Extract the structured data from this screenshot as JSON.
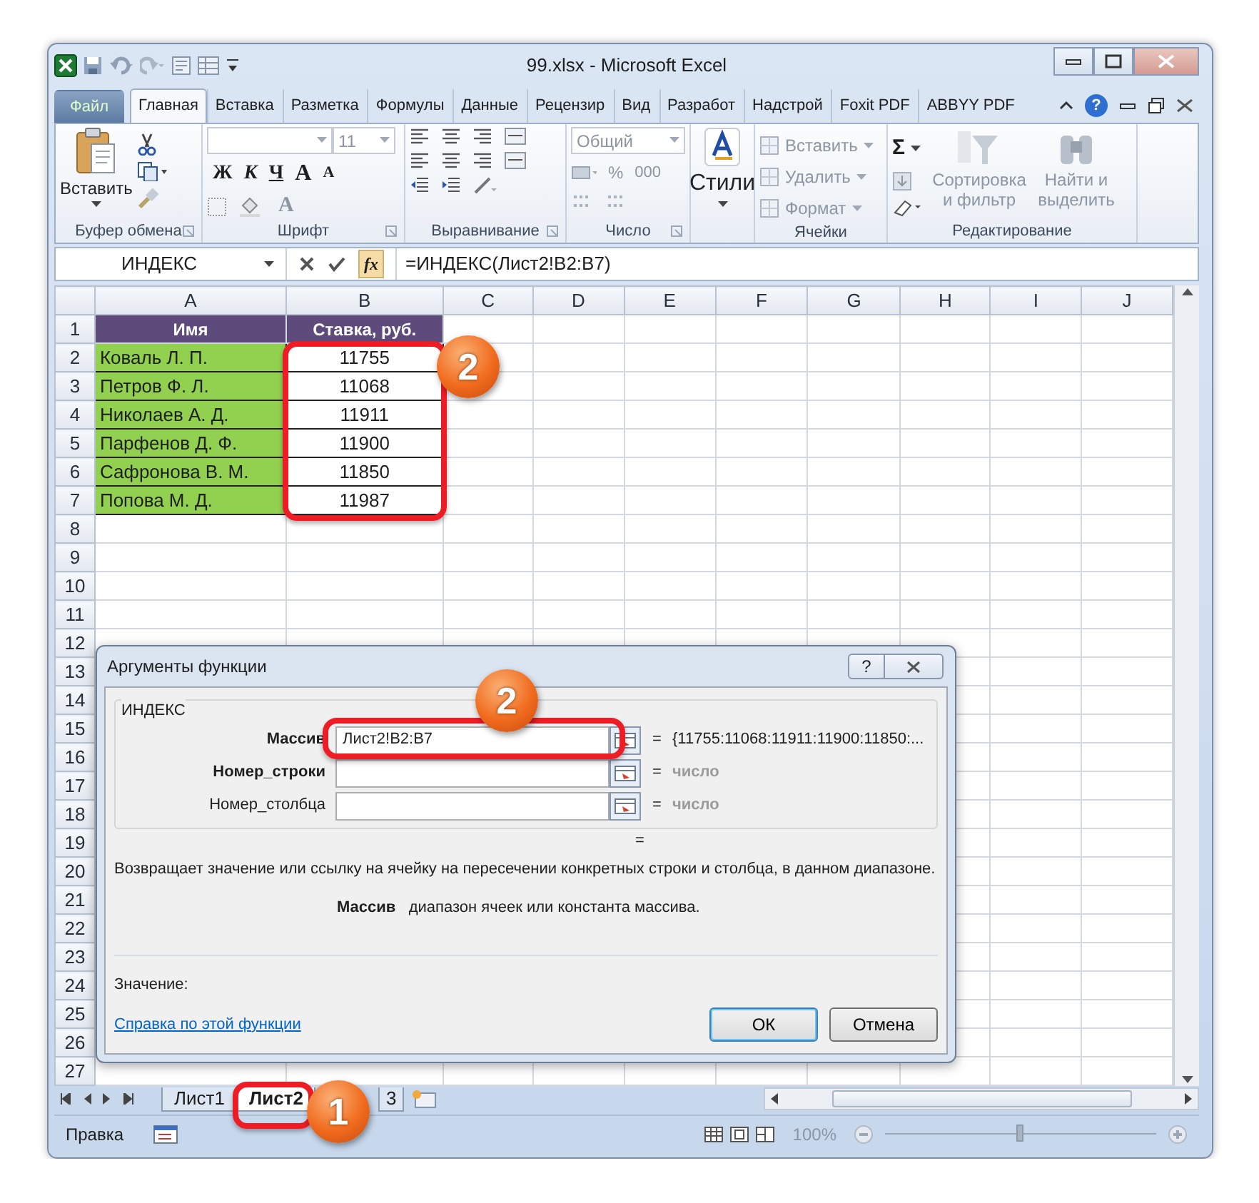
{
  "window": {
    "title": "99.xlsx - Microsoft Excel"
  },
  "ribbon_tabs": [
    {
      "label": "Файл",
      "kind": "file",
      "selected": false
    },
    {
      "label": "Главная",
      "kind": "tab",
      "selected": true
    },
    {
      "label": "Вставка",
      "kind": "tab",
      "selected": false
    },
    {
      "label": "Разметка",
      "kind": "tab",
      "selected": false
    },
    {
      "label": "Формулы",
      "kind": "tab",
      "selected": false
    },
    {
      "label": "Данные",
      "kind": "tab",
      "selected": false
    },
    {
      "label": "Рецензир",
      "kind": "tab",
      "selected": false
    },
    {
      "label": "Вид",
      "kind": "tab",
      "selected": false
    },
    {
      "label": "Разработ",
      "kind": "tab",
      "selected": false
    },
    {
      "label": "Надстрой",
      "kind": "tab",
      "selected": false
    },
    {
      "label": "Foxit PDF",
      "kind": "tab",
      "selected": false
    },
    {
      "label": "ABBYY PDF",
      "kind": "tab",
      "selected": false
    }
  ],
  "ribbon_help": "?",
  "ribbon_groups": [
    {
      "kind": "clipboard",
      "label": "Буфер обмена",
      "paste": "Вставить"
    },
    {
      "kind": "font",
      "label": "Шрифт",
      "font_size": "11",
      "styles": [
        "Ж",
        "К",
        "Ч"
      ],
      "grow": "A",
      "shrink": "A",
      "font_color": "A"
    },
    {
      "kind": "alignment",
      "label": "Выравнивание"
    },
    {
      "kind": "number",
      "label": "Число",
      "format": "Общий",
      "percent": "%",
      "thousands": "000",
      "disabled": true
    },
    {
      "kind": "styles",
      "label": "Стили"
    },
    {
      "kind": "cells",
      "label": "Ячейки",
      "commands": [
        "Вставить",
        "Удалить",
        "Формат"
      ],
      "disabled": true
    },
    {
      "kind": "editing",
      "label": "Редактирование",
      "sum": "Σ",
      "commands": [
        "Сортировка и фильтр",
        "Найти и выделить"
      ],
      "disabled": true
    }
  ],
  "formula_bar": {
    "name_box": "ИНДЕКС",
    "function_button": "fx",
    "formula": "=ИНДЕКС(Лист2!B2:B7)"
  },
  "columns": [
    "A",
    "B",
    "C",
    "D",
    "E",
    "F",
    "G",
    "H",
    "I",
    "J"
  ],
  "rows": [
    {
      "number": "1",
      "kind": "header",
      "cells": [
        "Имя",
        "Ставка, руб."
      ]
    },
    {
      "number": "2",
      "kind": "data",
      "cells": [
        "Коваль Л. П.",
        "11755"
      ]
    },
    {
      "number": "3",
      "kind": "data",
      "cells": [
        "Петров Ф. Л.",
        "11068"
      ]
    },
    {
      "number": "4",
      "kind": "data",
      "cells": [
        "Николаев А. Д.",
        "11911"
      ]
    },
    {
      "number": "5",
      "kind": "data",
      "cells": [
        "Парфенов Д. Ф.",
        "11900"
      ]
    },
    {
      "number": "6",
      "kind": "data",
      "cells": [
        "Сафронова В. М.",
        "11850"
      ]
    },
    {
      "number": "7",
      "kind": "data",
      "cells": [
        "Попова М. Д.",
        "11987"
      ]
    },
    {
      "number": "8",
      "kind": "empty"
    },
    {
      "number": "9",
      "kind": "empty"
    },
    {
      "number": "10",
      "kind": "empty"
    },
    {
      "number": "11",
      "kind": "empty"
    },
    {
      "number": "12",
      "kind": "empty"
    },
    {
      "number": "13",
      "kind": "empty"
    },
    {
      "number": "14",
      "kind": "empty"
    },
    {
      "number": "15",
      "kind": "empty"
    },
    {
      "number": "16",
      "kind": "empty"
    },
    {
      "number": "17",
      "kind": "empty"
    },
    {
      "number": "18",
      "kind": "empty"
    },
    {
      "number": "19",
      "kind": "empty"
    },
    {
      "number": "20",
      "kind": "empty"
    },
    {
      "number": "21",
      "kind": "empty"
    },
    {
      "number": "22",
      "kind": "empty"
    },
    {
      "number": "23",
      "kind": "empty"
    },
    {
      "number": "24",
      "kind": "empty"
    },
    {
      "number": "25",
      "kind": "empty"
    },
    {
      "number": "26",
      "kind": "empty"
    },
    {
      "number": "27",
      "kind": "empty"
    }
  ],
  "dialog": {
    "title": "Аргументы функции",
    "help_button": "?",
    "function_name": "ИНДЕКС",
    "arguments": [
      {
        "label": "Массив",
        "required": true,
        "value": "Лист2!B2:B7",
        "equals": "=",
        "result": "{11755:11068:11911:11900:11850:...",
        "kind": "value"
      },
      {
        "label": "Номер_строки",
        "required": true,
        "equals": "=",
        "result": "число",
        "kind": "hint"
      },
      {
        "label": "Номер_столбца",
        "required": false,
        "equals": "=",
        "result": "число",
        "kind": "hint"
      }
    ],
    "formula_equals": "=",
    "description": "Возвращает значение или ссылку на ячейку на пересечении конкретных строки и столбца, в данном диапазоне.",
    "argument_help": "**Массив**   диапазон ячеек или константа массива.",
    "value_label": "Значение:",
    "help_link": "Справка по этой функции",
    "buttons": [
      {
        "label": "ОК",
        "default": true
      },
      {
        "label": "Отмена",
        "default": false
      }
    ]
  },
  "sheet_tabs": [
    {
      "label": "Лист1",
      "selected": false
    },
    {
      "label": "Лист2",
      "selected": true
    },
    {
      "label": "3",
      "selected": false
    }
  ],
  "status_bar": {
    "mode": "Правка",
    "zoom": "100%",
    "zoom_level": {
      "level": 0.5
    }
  },
  "callouts": [
    {
      "number": "2"
    },
    {
      "number": "2"
    },
    {
      "number": "1"
    }
  ]
}
